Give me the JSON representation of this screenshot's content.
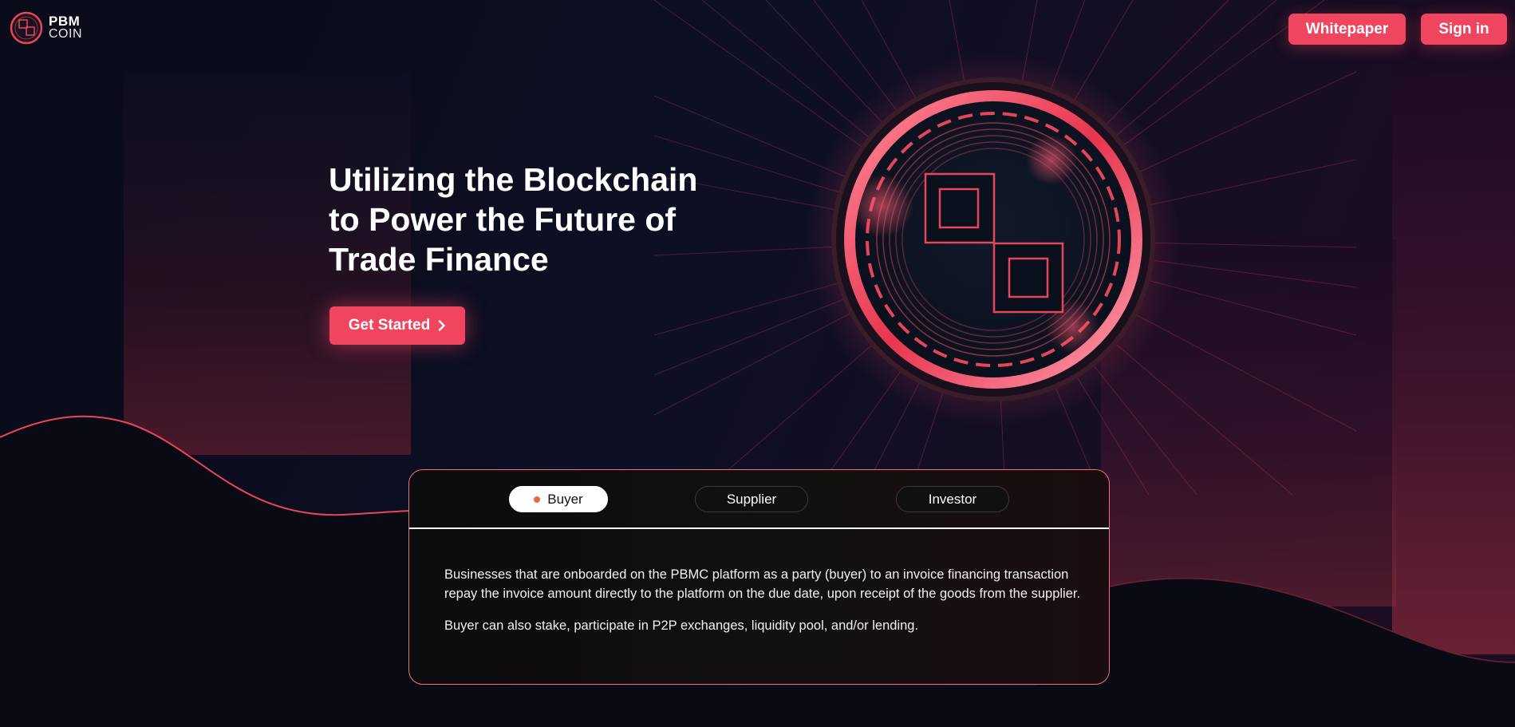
{
  "brand": {
    "name_line1": "PBM",
    "name_line2": "COIN"
  },
  "nav": {
    "whitepaper_label": "Whitepaper",
    "signin_label": "Sign in"
  },
  "hero": {
    "title_lines": [
      "Utilizing the Blockchain",
      "to Power the Future of",
      "Trade Finance"
    ],
    "cta_label": "Get Started"
  },
  "roles": {
    "tabs": [
      {
        "label": "Buyer",
        "active": true
      },
      {
        "label": "Supplier",
        "active": false
      },
      {
        "label": "Investor",
        "active": false
      }
    ],
    "active_content": {
      "paragraphs": [
        "Businesses that are onboarded on the PBMC platform as a party (buyer) to an invoice financing transaction repay the invoice amount directly to the platform on the due date, upon receipt of the goods from the supplier.",
        "Buyer can also stake, participate in P2P exchanges, liquidity pool, and/or lending."
      ]
    }
  },
  "icons": {
    "logo": "pbm-coin-logo-icon",
    "hero_art": "pbm-coin-emblem",
    "cta_arrow": "chevron-right-icon"
  },
  "colors": {
    "accent": "#f0455f",
    "background": "#0b0d1c",
    "card_border": "#f56c80",
    "active_tab_dot": "#f0663b"
  }
}
